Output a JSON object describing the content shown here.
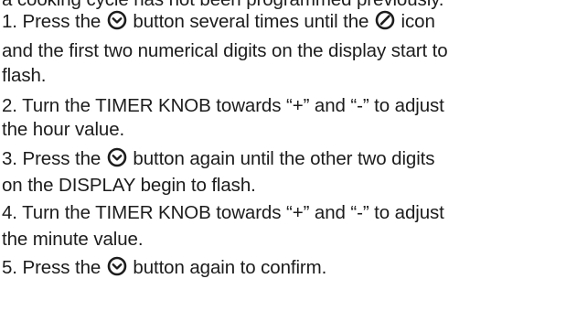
{
  "lines": [
    {
      "parts": [
        "a cooking cycle has not been programmed previously."
      ]
    },
    {
      "parts": [
        "1. Press the ",
        " button several times until the ",
        " icon"
      ]
    },
    {
      "parts": [
        "and the first two numerical digits on the display start to"
      ]
    },
    {
      "parts": [
        "flash."
      ]
    },
    {
      "parts": [
        "2. Turn the TIMER KNOB towards “+” and “-”  to adjust"
      ]
    },
    {
      "parts": [
        "the hour value."
      ]
    },
    {
      "parts": [
        "3. Press the ",
        " button again until the other two digits"
      ]
    },
    {
      "parts": [
        "on the DISPLAY begin to flash."
      ]
    },
    {
      "parts": [
        "4. Turn the TIMER KNOB towards “+” and “-” to adjust"
      ]
    },
    {
      "parts": [
        "the minute value."
      ]
    },
    {
      "parts": [
        "5. Press the ",
        " button again to confirm."
      ]
    }
  ],
  "icons": {
    "clock_button": "clock-check-icon",
    "timer": "timer-dial-icon"
  }
}
